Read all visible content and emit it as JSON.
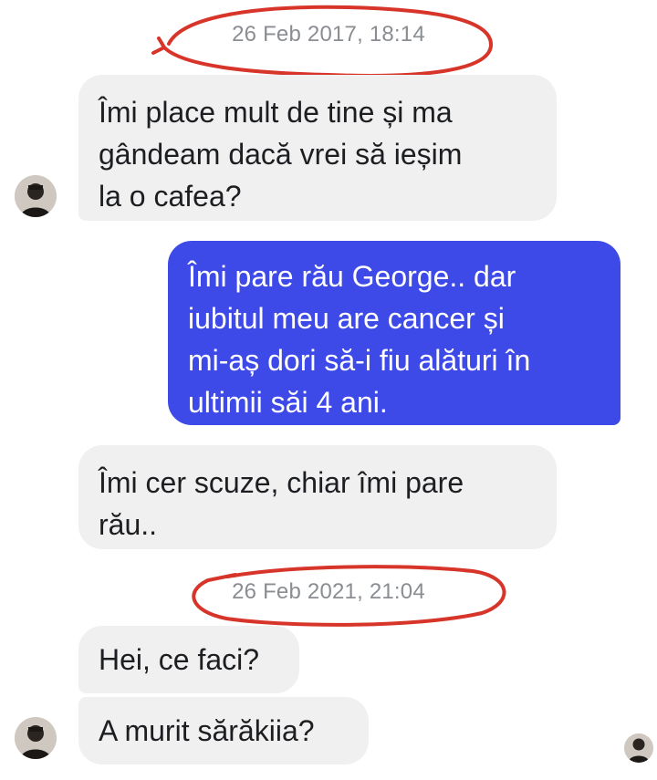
{
  "conversation": {
    "timestamps": [
      "26 Feb 2017, 18:14",
      "26 Feb 2021, 21:04"
    ],
    "messages": [
      {
        "sender": "George",
        "direction": "incoming",
        "text": "Îmi place mult de tine și ma\ngândeam dacă vrei să ieșim\nla o cafea?"
      },
      {
        "sender": "me",
        "direction": "outgoing",
        "text": "Îmi pare rău George.. dar\niubitul meu are cancer și\nmi-aș dori să-i fiu alături în\nultimii săi 4 ani."
      },
      {
        "sender": "George",
        "direction": "incoming",
        "text": "Îmi cer scuze, chiar îmi pare\nrău.."
      },
      {
        "sender": "George",
        "direction": "incoming",
        "text": "Hei, ce faci?"
      },
      {
        "sender": "George",
        "direction": "incoming",
        "text": "A murit sărăkiia?"
      }
    ]
  },
  "colors": {
    "incoming_bubble": "#f0f0f0",
    "outgoing_bubble": "#3d4ae8",
    "timestamp_text": "#8a8d91",
    "annotation_circle": "#d8352a"
  },
  "icons": {
    "contact_avatar": "profile-photo",
    "read_receipt": "seen-avatar"
  }
}
